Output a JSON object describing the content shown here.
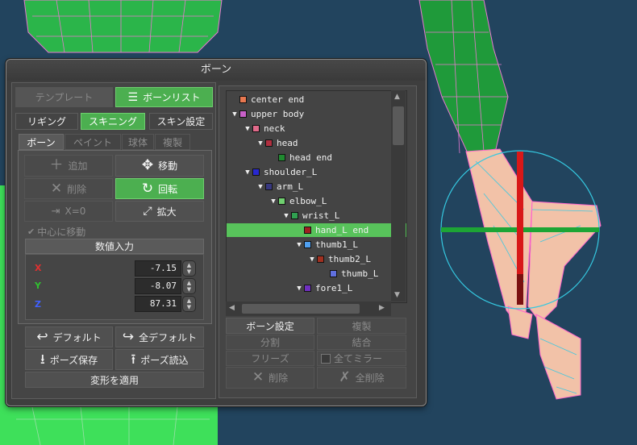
{
  "dialog": {
    "title": "ボーン"
  },
  "top_buttons": {
    "template": "テンプレート",
    "bone_list": "ボーンリスト"
  },
  "mode_tabs": {
    "rigging": "リギング",
    "skinning": "スキニング",
    "skin_settings": "スキン設定"
  },
  "sub_tabs": [
    "ボーン",
    "ペイント",
    "球体",
    "複製"
  ],
  "tools": {
    "add": "追加",
    "move": "移動",
    "delete": "削除",
    "rotate": "回転",
    "x0": "X=0",
    "scale": "拡大",
    "center_move": "中心に移動"
  },
  "numeric": {
    "header": "数値入力",
    "x_label": "X",
    "x_value": "-7.15",
    "y_label": "Y",
    "y_value": "-8.07",
    "z_label": "Z",
    "z_value": "87.31"
  },
  "bottom_left": {
    "default": "デフォルト",
    "all_default": "全デフォルト",
    "save_pose": "ポーズ保存",
    "load_pose": "ポーズ読込",
    "apply": "変形を適用"
  },
  "tree": {
    "rows": [
      {
        "label": "center end",
        "color": "#e87850",
        "depth": 0,
        "arrow": false,
        "selected": false
      },
      {
        "label": "upper body",
        "color": "#c860c8",
        "depth": 0,
        "arrow": true,
        "selected": false
      },
      {
        "label": "neck",
        "color": "#e06a8a",
        "depth": 1,
        "arrow": true,
        "selected": false
      },
      {
        "label": "head",
        "color": "#b03040",
        "depth": 2,
        "arrow": true,
        "selected": false
      },
      {
        "label": "head end",
        "color": "#208a30",
        "depth": 3,
        "arrow": false,
        "selected": false
      },
      {
        "label": "shoulder_L",
        "color": "#2828d0",
        "depth": 1,
        "arrow": true,
        "selected": false
      },
      {
        "label": "arm_L",
        "color": "#383880",
        "depth": 2,
        "arrow": true,
        "selected": false
      },
      {
        "label": "elbow_L",
        "color": "#70d070",
        "depth": 3,
        "arrow": true,
        "selected": false
      },
      {
        "label": "wrist_L",
        "color": "#30a050",
        "depth": 4,
        "arrow": true,
        "selected": false
      },
      {
        "label": "hand_L end",
        "color": "#a02020",
        "depth": 5,
        "arrow": false,
        "selected": true
      },
      {
        "label": "thumb1_L",
        "color": "#50a0f0",
        "depth": 5,
        "arrow": true,
        "selected": false
      },
      {
        "label": "thumb2_L",
        "color": "#a03020",
        "depth": 6,
        "arrow": true,
        "selected": false
      },
      {
        "label": "thumb_L",
        "color": "#6070e0",
        "depth": 7,
        "arrow": false,
        "selected": false
      },
      {
        "label": "fore1_L",
        "color": "#7030c0",
        "depth": 5,
        "arrow": true,
        "selected": false
      }
    ]
  },
  "right_buttons": {
    "bone_settings": "ボーン設定",
    "duplicate": "複製",
    "split": "分割",
    "merge": "結合",
    "freeze": "フリーズ",
    "all_mirror": "全てミラー",
    "delete": "削除",
    "delete_all": "全削除"
  },
  "colors": {
    "accent": "#4caf50",
    "axis_x": "#e03030",
    "axis_y": "#30c030",
    "axis_z": "#4060ff"
  }
}
